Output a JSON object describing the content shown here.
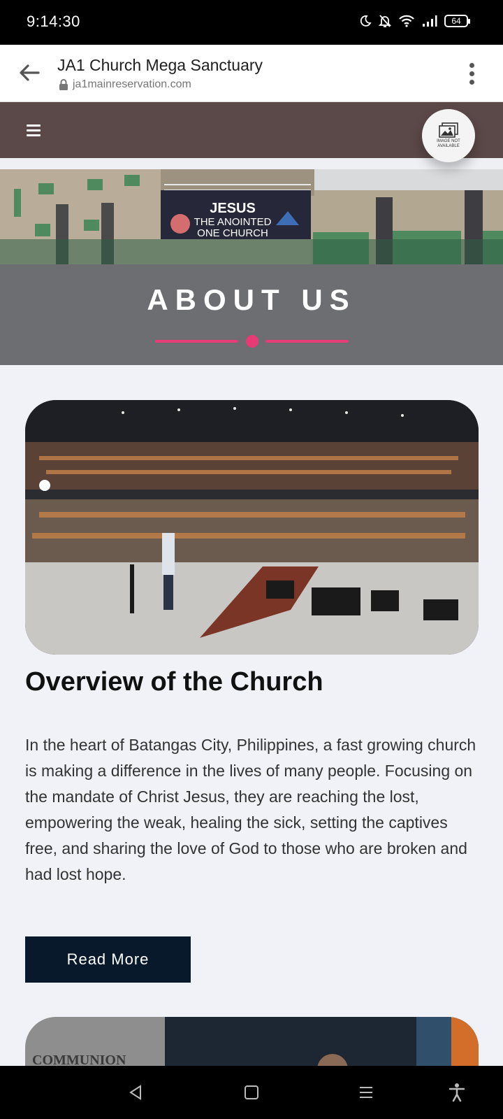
{
  "status_bar": {
    "time": "9:14:30",
    "battery": "64",
    "icons": [
      "moon-icon",
      "bell-off-icon",
      "wifi-icon",
      "signal-icon",
      "battery-icon"
    ]
  },
  "browser": {
    "page_title": "JA1 Church Mega Sanctuary",
    "url": "ja1mainreservation.com",
    "icons": [
      "back-arrow-icon",
      "lock-icon",
      "more-vert-icon"
    ]
  },
  "site_nav": {
    "menu_icon": "hamburger-icon",
    "logo_text": "IMAGE NOT AVAILABLE",
    "background": "#5b4848"
  },
  "hero": {
    "title": "ABOUT US",
    "sign_line1": "JESUS",
    "sign_line2": "THE ANOINTED",
    "sign_line3": "ONE CHURCH",
    "band_color": "#6d6e71",
    "accent_color": "#e83a75"
  },
  "overview": {
    "heading": "Overview of the Church",
    "body": "In the heart of Batangas City, Philippines, a fast growing church is making a difference in the lives of many people. Focusing on the mandate of Christ Jesus, they are reaching the lost, empowering the weak, healing the sick, setting the captives free, and sharing the love of God to those who are broken and had lost hope.",
    "button_label": "Read More",
    "button_color": "#07192b"
  },
  "second_card": {
    "partial_text": "COMMUNION"
  },
  "nav_bar": {
    "icons": [
      "back-triangle-icon",
      "home-square-icon",
      "recents-icon",
      "accessibility-icon"
    ]
  }
}
